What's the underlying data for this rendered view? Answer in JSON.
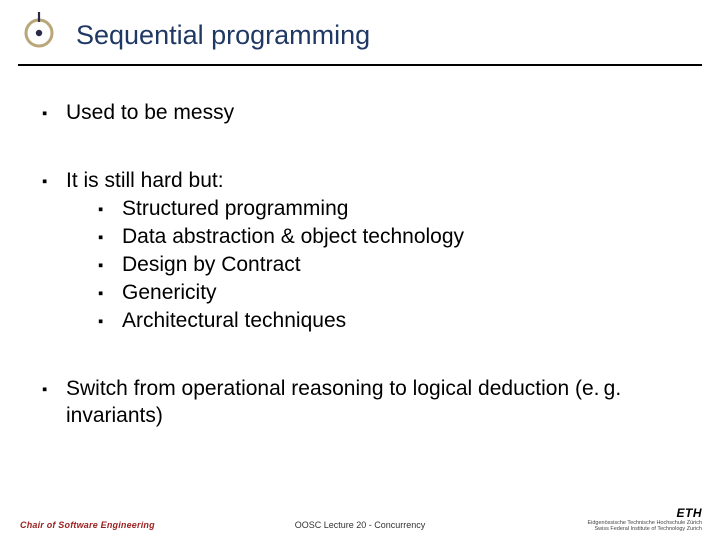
{
  "title": "Sequential programming",
  "bullets": {
    "b1": "Used to be messy",
    "b2": "It is still hard but:",
    "sub": {
      "s1": "Structured programming",
      "s2": "Data abstraction & object technology",
      "s3": "Design by Contract",
      "s4": "Genericity",
      "s5": "Architectural techniques"
    },
    "b3": "Switch from operational reasoning to logical deduction (e. g. invariants)"
  },
  "footer": {
    "left": "Chair of Software Engineering",
    "center": "OOSC  Lecture 20 - Concurrency",
    "brand": "ETH",
    "brand_sub1": "Eidgenössische Technische Hochschule Zürich",
    "brand_sub2": "Swiss Federal Institute of Technology Zurich"
  }
}
